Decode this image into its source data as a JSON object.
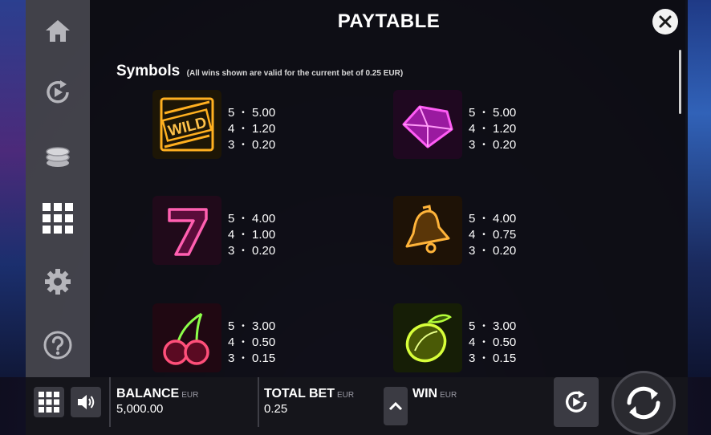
{
  "panel": {
    "title": "PAYTABLE",
    "section_title": "Symbols",
    "section_note": "(All wins shown are valid for the current bet of 0.25 EUR)"
  },
  "menu": {
    "items": [
      {
        "icon": "home-icon"
      },
      {
        "icon": "autoplay-icon"
      },
      {
        "icon": "coins-icon"
      },
      {
        "icon": "paytable-grid-icon",
        "active": true
      },
      {
        "icon": "settings-gear-icon"
      },
      {
        "icon": "help-icon"
      }
    ]
  },
  "symbols": [
    {
      "icon": "wild-icon",
      "word": "WILD",
      "color": "#ffb020",
      "pays": [
        {
          "count": "5",
          "value": "5.00"
        },
        {
          "count": "4",
          "value": "1.20"
        },
        {
          "count": "3",
          "value": "0.20"
        }
      ]
    },
    {
      "icon": "diamond-icon",
      "color": "#ff3df0",
      "pays": [
        {
          "count": "5",
          "value": "5.00"
        },
        {
          "count": "4",
          "value": "1.20"
        },
        {
          "count": "3",
          "value": "0.20"
        }
      ]
    },
    {
      "icon": "seven-icon",
      "color": "#ff5fb0",
      "pays": [
        {
          "count": "5",
          "value": "4.00"
        },
        {
          "count": "4",
          "value": "1.00"
        },
        {
          "count": "3",
          "value": "0.20"
        }
      ]
    },
    {
      "icon": "bell-icon",
      "color": "#ffb43a",
      "pays": [
        {
          "count": "5",
          "value": "4.00"
        },
        {
          "count": "4",
          "value": "0.75"
        },
        {
          "count": "3",
          "value": "0.20"
        }
      ]
    },
    {
      "icon": "cherry-icon",
      "color": "#ff4f7a",
      "pays": [
        {
          "count": "5",
          "value": "3.00"
        },
        {
          "count": "4",
          "value": "0.50"
        },
        {
          "count": "3",
          "value": "0.15"
        }
      ]
    },
    {
      "icon": "lime-icon",
      "color": "#d8ff3a",
      "pays": [
        {
          "count": "5",
          "value": "3.00"
        },
        {
          "count": "4",
          "value": "0.50"
        },
        {
          "count": "3",
          "value": "0.15"
        }
      ]
    }
  ],
  "bottom_bar": {
    "balance_label": "BALANCE",
    "balance_unit": "EUR",
    "balance_value": "5,000.00",
    "bet_label": "TOTAL BET",
    "bet_unit": "EUR",
    "bet_value": "0.25",
    "win_label": "WIN",
    "win_unit": "EUR"
  }
}
